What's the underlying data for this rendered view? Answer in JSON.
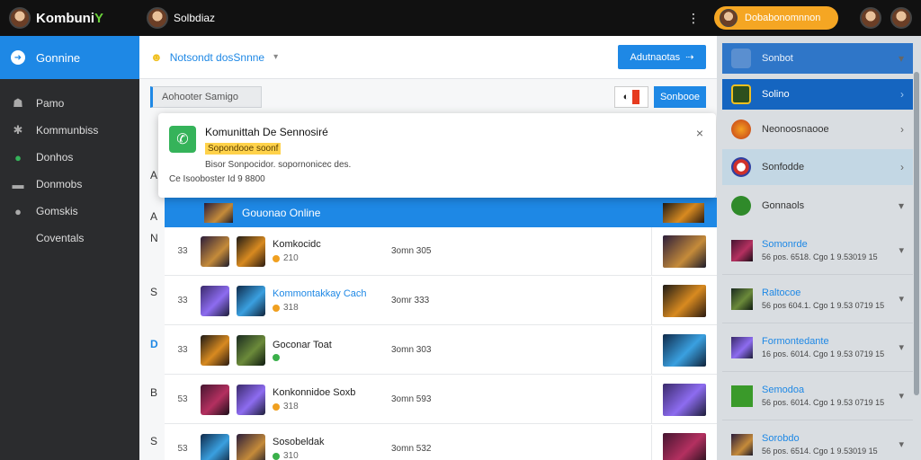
{
  "topbar": {
    "logo": {
      "main": "Kombuni",
      "accent": "Y"
    },
    "user_name": "Solbdiaz",
    "menu_icon": "dots-icon",
    "pill_label": "Dobabonomnnon"
  },
  "sidebar": {
    "header": "Gonnine",
    "items": [
      {
        "label": "Pamo",
        "icon": "user-group-icon"
      },
      {
        "label": "Kommunbiss",
        "icon": "puzzle-icon"
      },
      {
        "label": "Donhos",
        "icon": "chat-bubble-icon"
      },
      {
        "label": "Donmobs",
        "icon": "card-icon"
      },
      {
        "label": "Gomskis",
        "icon": "circle-icon"
      },
      {
        "label": "Coventals",
        "icon": ""
      }
    ]
  },
  "main": {
    "title": "Notsondt dosSnnne",
    "action_button": "Adutnaotas",
    "search_placeholder": "Aohooter Samigo",
    "secondary_button": "Sonbooe",
    "left_letters": [
      "A",
      "A",
      "N",
      "S",
      "D",
      "B",
      "S"
    ],
    "selected_row": {
      "label": "Gouonao Online"
    },
    "rows": [
      {
        "rank": "33",
        "name": "Komkocidc",
        "name_blue": false,
        "sub": "210",
        "dot": "orange",
        "score": "3omn 305"
      },
      {
        "rank": "33",
        "name": "Kommontakkay Cach",
        "name_blue": true,
        "sub": "318",
        "dot": "orange",
        "score": "3omr 333"
      },
      {
        "rank": "33",
        "name": "Goconar Toat",
        "name_blue": false,
        "sub": "",
        "dot": "green",
        "score": "3omn 303"
      },
      {
        "rank": "53",
        "name": "Konkonnidoe Soxb",
        "name_blue": false,
        "sub": "318",
        "dot": "orange",
        "score": "3omn 593"
      },
      {
        "rank": "53",
        "name": "Sosobeldak",
        "name_blue": false,
        "sub": "310",
        "dot": "green",
        "score": "3omn 532"
      }
    ]
  },
  "toast": {
    "title": "Komunittah De Sennosiré",
    "badge": "Sopondooe soonf",
    "message": "Bisor Sonpocidor. sopornonicec des.",
    "footer": "Ce Isooboster Id 9 8800",
    "close": "×"
  },
  "right_sidebar": {
    "items": [
      {
        "label": "Sonbot",
        "style": "mid"
      },
      {
        "label": "Solino",
        "style": "blue"
      },
      {
        "label": "Neonoosnaooe",
        "style": "plain"
      },
      {
        "label": "Sonfodde",
        "style": "light"
      },
      {
        "label": "Gonnaols",
        "style": "plain"
      }
    ],
    "list": [
      {
        "name": "Somonrde",
        "sub": "56 pos. 6518. Cgo 1 9.53019 15"
      },
      {
        "name": "Raltocoe",
        "sub": "56 pos 604.1. Cgo 1 9.53 0719 15"
      },
      {
        "name": "Formontedante",
        "sub": "16 pos. 6014. Cgo 1 9.53 0719 15"
      },
      {
        "name": "Semodoa",
        "sub": "56 pos. 6014. Cgo 1 9.53 0719 15"
      },
      {
        "name": "Sorobdo",
        "sub": "56 pos. 6514. Cgo 1 9.53019 15"
      }
    ]
  }
}
